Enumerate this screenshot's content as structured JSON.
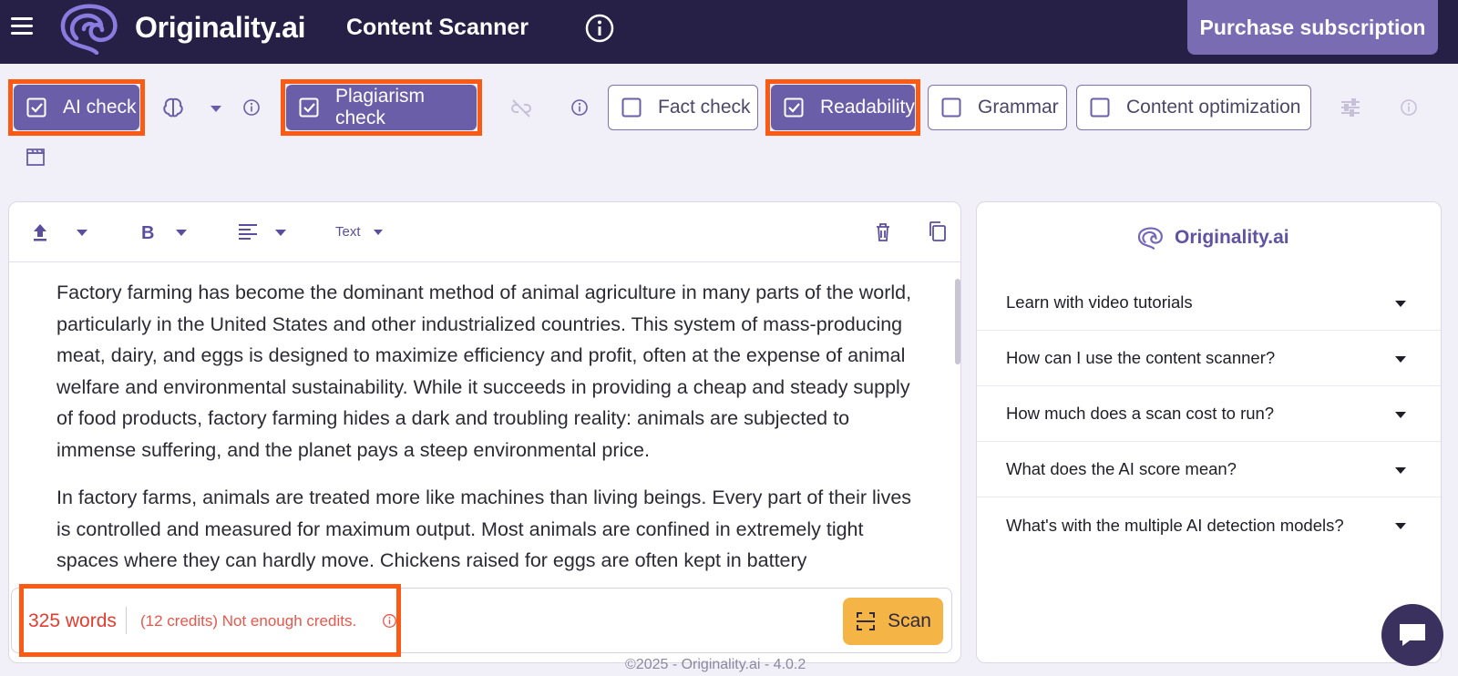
{
  "header": {
    "brand": "Originality.ai",
    "app_title": "Content Scanner",
    "purchase_label": "Purchase subscription"
  },
  "checks": {
    "ai_check": {
      "label": "AI check",
      "checked": true
    },
    "plagiarism_check": {
      "label": "Plagiarism check",
      "checked": true
    },
    "fact_check": {
      "label": "Fact check",
      "checked": false
    },
    "readability": {
      "label": "Readability",
      "checked": true
    },
    "grammar": {
      "label": "Grammar",
      "checked": false
    },
    "content_optimization": {
      "label": "Content optimization",
      "checked": false
    }
  },
  "editor": {
    "format_label": "Text",
    "paragraphs": [
      "Factory farming has become the dominant method of animal agriculture in many parts of the world, particularly in the United States and other industrialized countries. This system of mass-producing meat, dairy, and eggs is designed to maximize efficiency and profit, often at the expense of animal welfare and environmental sustainability. While it succeeds in providing a cheap and steady supply of food products, factory farming hides a dark and troubling reality: animals are subjected to immense suffering, and the planet pays a steep environmental price.",
      "In factory farms, animals are treated more like machines than living beings. Every part of their lives is controlled and measured for maximum output. Most animals are confined in extremely tight spaces where they can hardly move. Chickens raised for eggs are often kept in battery"
    ]
  },
  "footer": {
    "word_count": "325 words",
    "credits_message": "(12 credits) Not enough credits.",
    "scan_label": "Scan"
  },
  "panel": {
    "brand": "Originality.ai",
    "faqs": [
      "Learn with video tutorials",
      "How can I use the content scanner?",
      "How much does a scan cost to run?",
      "What does the AI score mean?",
      "What's with the multiple AI detection models?"
    ]
  },
  "copyright": "©2025 - Originality.ai - 4.0.2",
  "colors": {
    "header_bg": "#272046",
    "accent": "#6b5ea8",
    "highlight": "#fb5a14",
    "scan_button": "#f5b546",
    "warning_text": "#e53b2f"
  }
}
